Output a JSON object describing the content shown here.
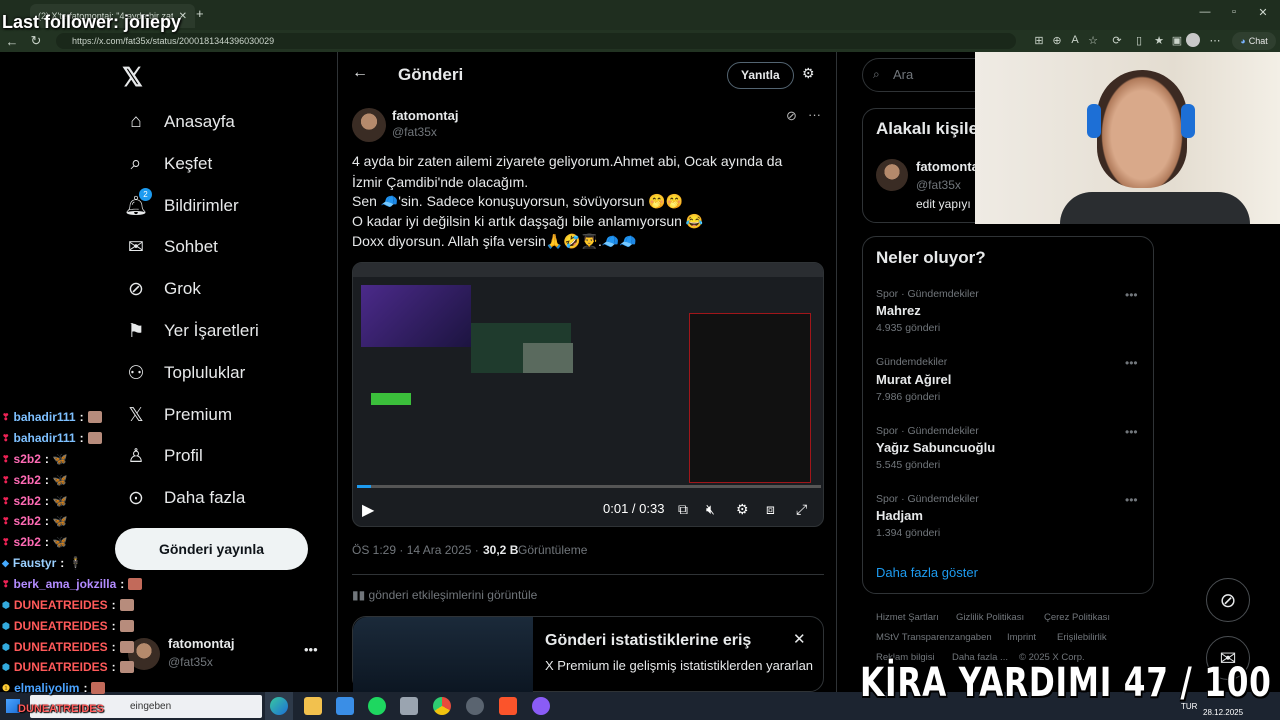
{
  "browser": {
    "tab_active_label": "(2) X'te fatomontaj: \"4 ayda bir zat...",
    "url": "https://x.com/fat35x/status/2000181344396030029",
    "chat_label": "Chat"
  },
  "overlay": {
    "last_follower": "Last follower: joliepy",
    "donation_text": "KİRA YARDIMI 47 / 100"
  },
  "sidebar": {
    "items": [
      {
        "label": "Anasayfa",
        "icon": "home-icon"
      },
      {
        "label": "Keşfet",
        "icon": "search-icon"
      },
      {
        "label": "Bildirimler",
        "icon": "bell-icon",
        "badge": "2"
      },
      {
        "label": "Sohbet",
        "icon": "mail-icon"
      },
      {
        "label": "Grok",
        "icon": "grok-icon"
      },
      {
        "label": "Yer İşaretleri",
        "icon": "bookmark-icon"
      },
      {
        "label": "Topluluklar",
        "icon": "people-icon"
      },
      {
        "label": "Premium",
        "icon": "x-icon"
      },
      {
        "label": "Profil",
        "icon": "person-icon"
      },
      {
        "label": "Daha fazla",
        "icon": "more-circle-icon"
      }
    ],
    "post_button": "Gönderi yayınla",
    "account_name": "fatomontaj",
    "account_handle": "@fat35x"
  },
  "main": {
    "title": "Gönderi",
    "reply_button": "Yanıtla",
    "author_name": "fatomontaj",
    "author_handle": "@fat35x",
    "tweet_lines": [
      "4 ayda bir zaten ailemi ziyarete geliyorum.Ahmet abi, Ocak ayında da",
      "İzmir Çamdibi'nde olacağım.",
      "Sen 🧢'sin. Sadece konuşuyorsun, sövüyorsun 🤭🤭",
      "O kadar iyi değilsin ki artık daşşağı bile anlamıyorsun 😂",
      "Doxx diyorsun. Allah şifa versin🙏🤣👨‍🎓.🧢🧢"
    ],
    "video_time": "0:01 / 0:33",
    "meta_time": "ÖS 1:29 · 14 Ara 2025 ·",
    "views": "30,2 B",
    "views_label": "Görüntüleme",
    "engagement_link": "gönderi etkileşimlerini görüntüle",
    "stats_title": "Gönderi istatistiklerine eriş",
    "stats_subtitle": "X Premium ile gelişmiş istatistiklerden yararlan"
  },
  "right": {
    "search_placeholder": "Ara",
    "related_title": "Alakalı kişiler",
    "related_name": "fatomontaj",
    "related_handle": "@fat35x",
    "related_bio": "edit yapıyı",
    "trends_title": "Neler oluyor?",
    "trends": [
      {
        "context": "Spor · Gündemdekiler",
        "name": "Mahrez",
        "count": "4.935 gönderi"
      },
      {
        "context": "Gündemdekiler",
        "name": "Murat Ağırel",
        "count": "7.986 gönderi"
      },
      {
        "context": "Spor · Gündemdekiler",
        "name": "Yağız Sabuncuoğlu",
        "count": "5.545 gönderi"
      },
      {
        "context": "Spor · Gündemdekiler",
        "name": "Hadjam",
        "count": "1.394 gönderi"
      }
    ],
    "show_more": "Daha fazla göster",
    "footer_row1": [
      "Hizmet Şartları",
      "Gizlilik Politikası",
      "Çerez Politikası"
    ],
    "footer_row2": [
      "MStV Transparenzangaben",
      "Imprint",
      "Erişilebilirlik"
    ],
    "footer_row3": [
      "Reklam bilgisi",
      "Daha fazla ...",
      "© 2025 X Corp."
    ]
  },
  "chat": [
    {
      "user": "bahadir111",
      "color": "#7ec0ff"
    },
    {
      "user": "bahadir111",
      "color": "#7ec0ff"
    },
    {
      "user": "s2b2",
      "color": "#ff6bb5"
    },
    {
      "user": "s2b2",
      "color": "#ff6bb5"
    },
    {
      "user": "s2b2",
      "color": "#ff6bb5"
    },
    {
      "user": "s2b2",
      "color": "#ff6bb5"
    },
    {
      "user": "s2b2",
      "color": "#ff6bb5"
    },
    {
      "user": "Faustyr",
      "color": "#9ad0ff"
    },
    {
      "user": "berk_ama_jokzilla",
      "color": "#b38cff"
    },
    {
      "user": "DUNEATREIDES",
      "color": "#ff5a5a"
    },
    {
      "user": "DUNEATREIDES",
      "color": "#ff5a5a"
    },
    {
      "user": "DUNEATREIDES",
      "color": "#ff5a5a"
    },
    {
      "user": "DUNEATREIDES",
      "color": "#ff5a5a"
    },
    {
      "user": "elmaliyolim",
      "color": "#4aa3ff"
    },
    {
      "user": "DUNEATREIDES",
      "color": "#ff5a5a"
    }
  ],
  "taskbar": {
    "search_text": "eingeben",
    "lang": "TUR",
    "date": "28.12.2025"
  }
}
